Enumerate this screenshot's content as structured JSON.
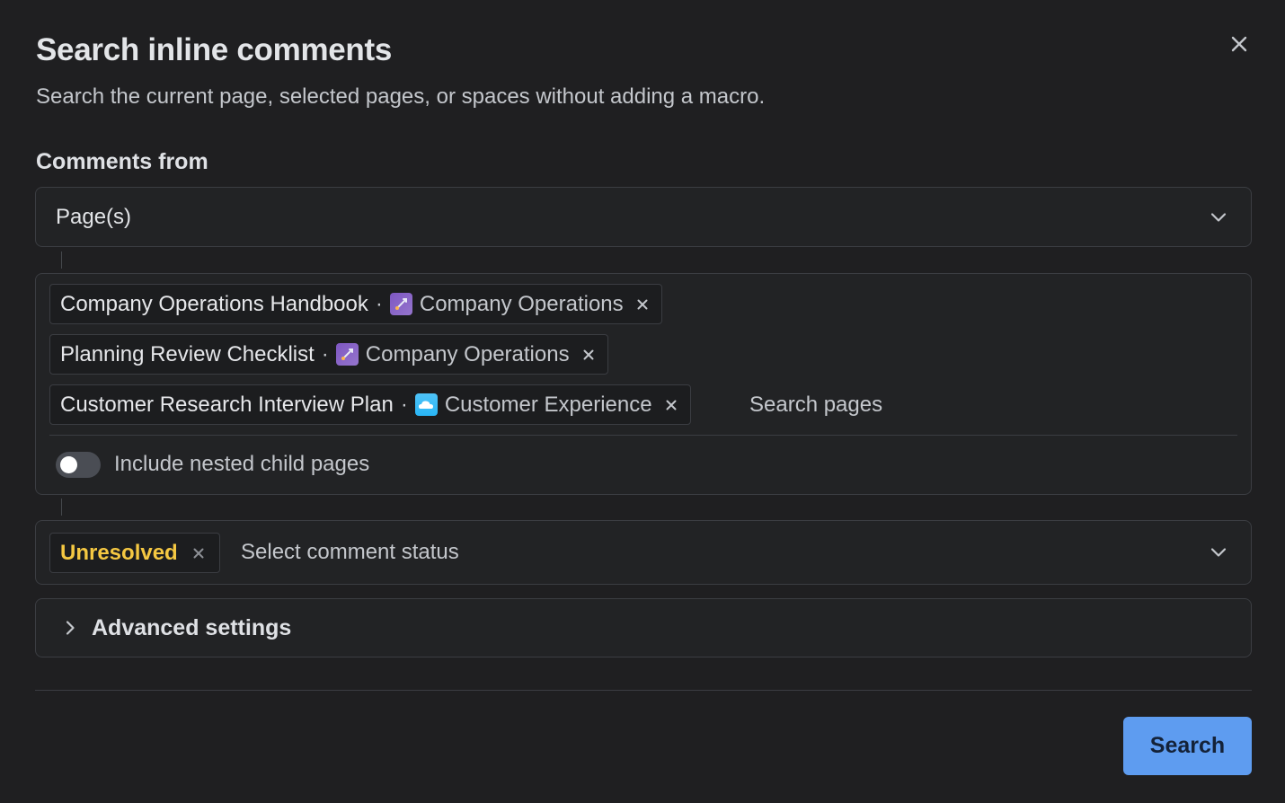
{
  "dialog": {
    "title": "Search inline comments",
    "subtitle": "Search the current page, selected pages, or spaces without adding a macro.",
    "close_icon": "close-icon"
  },
  "comments_from": {
    "label": "Comments from",
    "selected": "Page(s)"
  },
  "pages": {
    "chips": [
      {
        "page": "Company Operations Handbook",
        "separator": "·",
        "space_icon": "rocket-icon",
        "space": "Company Operations"
      },
      {
        "page": "Planning Review Checklist",
        "separator": "·",
        "space_icon": "rocket-icon",
        "space": "Company Operations"
      },
      {
        "page": "Customer Research Interview Plan",
        "separator": "·",
        "space_icon": "cloud-icon",
        "space": "Customer Experience"
      }
    ],
    "search_placeholder": "Search pages",
    "nested_toggle_label": "Include nested child pages",
    "nested_toggle_on": false
  },
  "status": {
    "selected_chip": "Unresolved",
    "placeholder": "Select comment status",
    "chip_color": "#f5c842"
  },
  "advanced": {
    "label": "Advanced settings"
  },
  "footer": {
    "search_label": "Search",
    "accent": "#5e9cf0"
  }
}
